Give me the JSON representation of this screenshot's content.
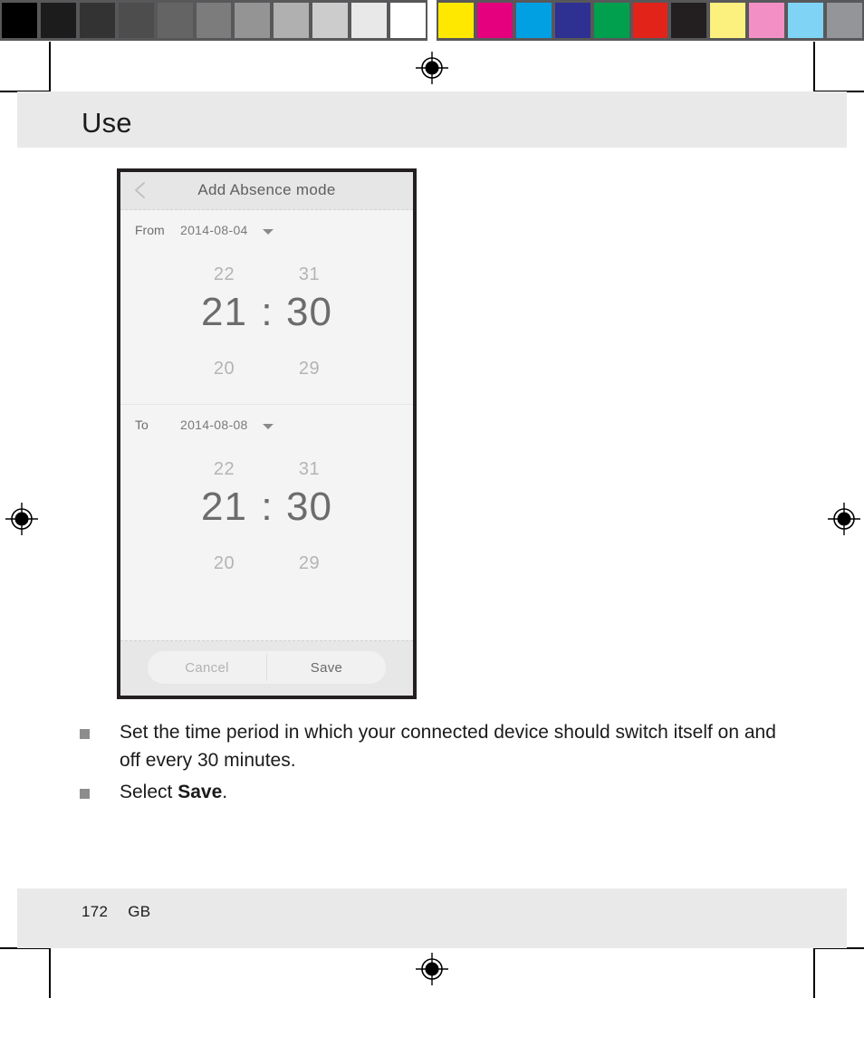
{
  "calibration": {
    "grayscale_patches": [
      "#000000",
      "#1c1c1c",
      "#333333",
      "#4d4d4d",
      "#646464",
      "#7c7c7c",
      "#949494",
      "#b0b0b0",
      "#cccccc",
      "#e8e8e8",
      "#ffffff"
    ],
    "color_patches": [
      "#ffe800",
      "#e5007e",
      "#00a0e3",
      "#2e3192",
      "#00a04e",
      "#e2231a",
      "#231f20",
      "#fcf07f",
      "#f290c5",
      "#7fd4f5",
      "#939598"
    ],
    "strip_background": "#58585a"
  },
  "page": {
    "header_title": "Use",
    "footer_page_number": "172",
    "footer_language": "GB",
    "band_color": "#e9e9e9",
    "text_color": "#1b1b1b"
  },
  "screenshot": {
    "titlebar": {
      "back_icon": "chevron-left-icon",
      "title": "Add Absence mode"
    },
    "ranges": [
      {
        "label": "From",
        "date": "2014-08-04",
        "caret_icon": "caret-down-icon",
        "time": {
          "hour_above": "22",
          "minute_above": "31",
          "hour_selected": "21",
          "separator": ":",
          "minute_selected": "30",
          "hour_below": "20",
          "minute_below": "29"
        }
      },
      {
        "label": "To",
        "date": "2014-08-08",
        "caret_icon": "caret-down-icon",
        "time": {
          "hour_above": "22",
          "minute_above": "31",
          "hour_selected": "21",
          "separator": ":",
          "minute_selected": "30",
          "hour_below": "20",
          "minute_below": "29"
        }
      }
    ],
    "footer": {
      "cancel_label": "Cancel",
      "save_label": "Save"
    }
  },
  "instructions": {
    "items": [
      {
        "text_before": "Set the time period in which your connected device should switch itself on and off every 30 minutes.",
        "bold": "",
        "text_after": ""
      },
      {
        "text_before": "Select ",
        "bold": "Save",
        "text_after": "."
      }
    ]
  }
}
